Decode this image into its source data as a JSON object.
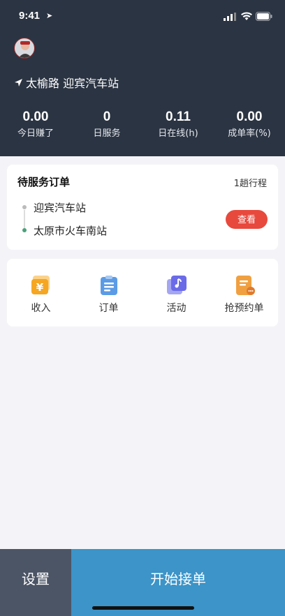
{
  "status_bar": {
    "time": "9:41"
  },
  "header": {
    "location": "太榆路 迎宾汽车站",
    "stats": [
      {
        "value": "0.00",
        "label": "今日赚了"
      },
      {
        "value": "0",
        "label": "日服务"
      },
      {
        "value": "0.11",
        "label": "日在线(h)"
      },
      {
        "value": "0.00",
        "label": "成单率(%)"
      }
    ]
  },
  "order": {
    "title": "待服务订单",
    "trips": "1趟行程",
    "from": "迎宾汽车站",
    "to": "太原市火车南站",
    "view_label": "查看"
  },
  "menu": [
    {
      "label": "收入",
      "icon": "yuan-icon",
      "color": "#f5a623"
    },
    {
      "label": "订单",
      "icon": "clipboard-icon",
      "color": "#5b9be6"
    },
    {
      "label": "活动",
      "icon": "music-card-icon",
      "color": "#6b6be8"
    },
    {
      "label": "抢预约单",
      "icon": "document-more-icon",
      "color": "#f0a040"
    }
  ],
  "bottom": {
    "settings_label": "设置",
    "start_label": "开始接单"
  },
  "colors": {
    "header_bg": "#2b3442",
    "accent_red": "#e8493d",
    "start_blue": "#3c94c8",
    "settings_bg": "#4c5566"
  }
}
